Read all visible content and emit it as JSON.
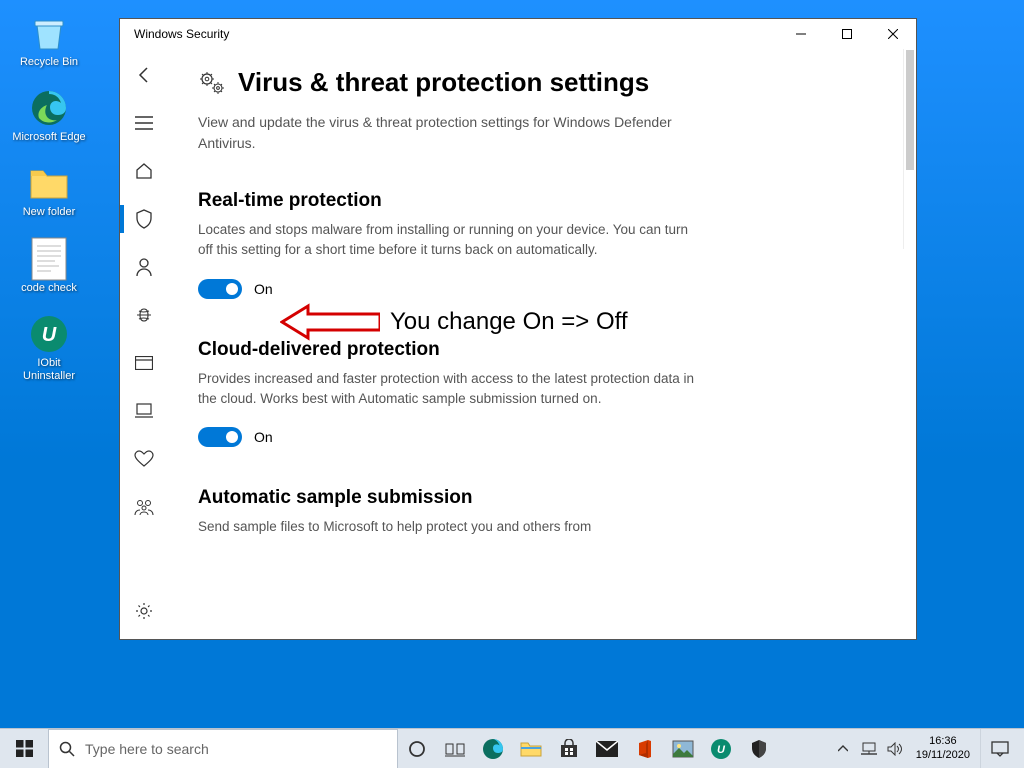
{
  "desktop": {
    "icons": [
      {
        "name": "recycle-bin",
        "label": "Recycle Bin"
      },
      {
        "name": "microsoft-edge",
        "label": "Microsoft Edge"
      },
      {
        "name": "new-folder",
        "label": "New folder"
      },
      {
        "name": "code-check",
        "label": "code check"
      },
      {
        "name": "iobit-uninstaller",
        "label": "IObit Uninstaller"
      }
    ]
  },
  "window": {
    "title": "Windows Security",
    "page_title": "Virus & threat protection settings",
    "page_sub": "View and update the virus & threat protection settings for Windows Defender Antivirus.",
    "sections": {
      "realtime": {
        "title": "Real-time protection",
        "desc": "Locates and stops malware from installing or running on your device. You can turn off this setting for a short time before it turns back on automatically.",
        "state": "On"
      },
      "cloud": {
        "title": "Cloud-delivered protection",
        "desc": "Provides increased and faster protection with access to the latest protection data in the cloud. Works best with Automatic sample submission turned on.",
        "state": "On"
      },
      "auto": {
        "title": "Automatic sample submission",
        "desc": "Send sample files to Microsoft to help protect you and others from"
      }
    }
  },
  "annotation": {
    "text": "You change On => Off"
  },
  "taskbar": {
    "search_placeholder": "Type here to search",
    "clock_time": "16:36",
    "clock_date": "19/11/2020"
  }
}
